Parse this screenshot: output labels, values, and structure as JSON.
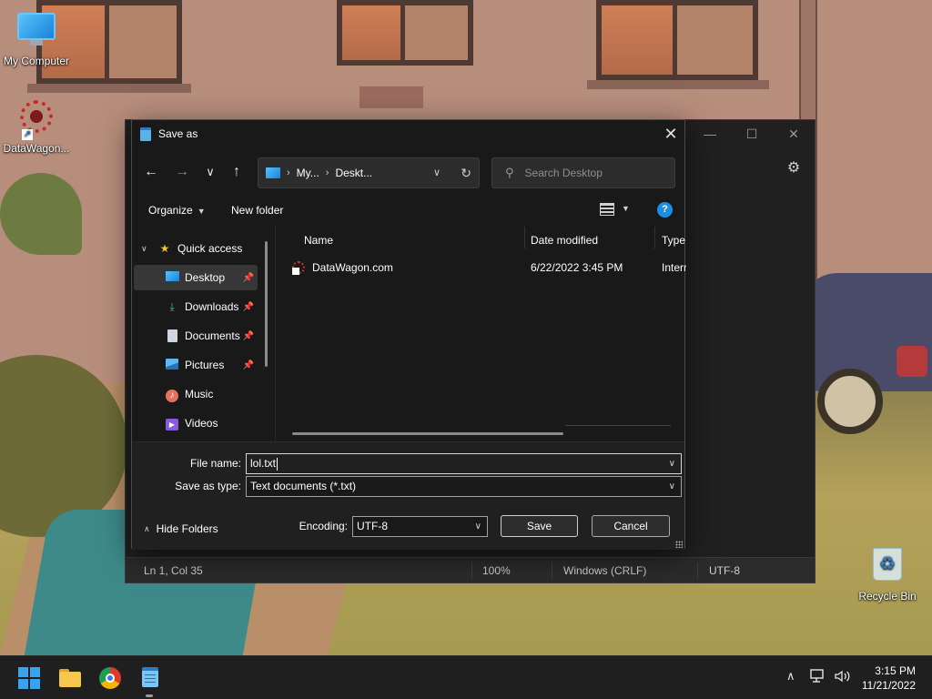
{
  "desktop": {
    "icons": [
      {
        "label": "My Computer",
        "icon": "monitor-icon"
      },
      {
        "label": "DataWagon...",
        "icon": "datawagon-icon"
      },
      {
        "label": "Recycle Bin",
        "icon": "recycle-bin-icon"
      }
    ]
  },
  "notepad": {
    "title_buttons": {
      "minimize": "—",
      "maximize": "☐",
      "close": "✕"
    },
    "settings_icon": "gear-icon",
    "status": {
      "position": "Ln 1, Col 35",
      "zoom": "100%",
      "line_ending": "Windows (CRLF)",
      "encoding": "UTF-8"
    }
  },
  "dialog": {
    "title": "Save as",
    "close_glyph": "✕",
    "nav": {
      "back": "←",
      "forward": "→",
      "recent": "∨",
      "up": "↑",
      "breadcrumb": [
        "My...",
        "Deskt..."
      ],
      "search_placeholder": "Search Desktop"
    },
    "toolbar": {
      "organize": "Organize",
      "new_folder": "New folder",
      "help": "?"
    },
    "nav_pane": [
      {
        "label": "Quick access",
        "icon": "star-icon",
        "expanded": true,
        "pinned": false,
        "selected": false,
        "indent": 0
      },
      {
        "label": "Desktop",
        "icon": "desktop-icon",
        "pinned": true,
        "selected": true,
        "indent": 1
      },
      {
        "label": "Downloads",
        "icon": "download-icon",
        "pinned": true,
        "selected": false,
        "indent": 1
      },
      {
        "label": "Documents",
        "icon": "documents-icon",
        "pinned": true,
        "selected": false,
        "indent": 1
      },
      {
        "label": "Pictures",
        "icon": "pictures-icon",
        "pinned": true,
        "selected": false,
        "indent": 1
      },
      {
        "label": "Music",
        "icon": "music-icon",
        "pinned": false,
        "selected": false,
        "indent": 1
      },
      {
        "label": "Videos",
        "icon": "videos-icon",
        "pinned": false,
        "selected": false,
        "indent": 1
      }
    ],
    "columns": [
      "Name",
      "Date modified",
      "Type"
    ],
    "files": [
      {
        "name": "DataWagon.com",
        "date": "6/22/2022 3:45 PM",
        "type": "Intern"
      }
    ],
    "file_name_label": "File name:",
    "file_name_value": "lol.txt",
    "save_type_label": "Save as type:",
    "save_type_value": "Text documents (*.txt)",
    "hide_folders": "Hide Folders",
    "encoding_label": "Encoding:",
    "encoding_value": "UTF-8",
    "save_button": "Save",
    "cancel_button": "Cancel"
  },
  "taskbar": {
    "apps": [
      "start-icon",
      "file-explorer-icon",
      "chrome-icon",
      "notepad-icon"
    ],
    "tray": {
      "chevron": "∧"
    },
    "time": "3:15 PM",
    "date": "11/21/2022"
  }
}
